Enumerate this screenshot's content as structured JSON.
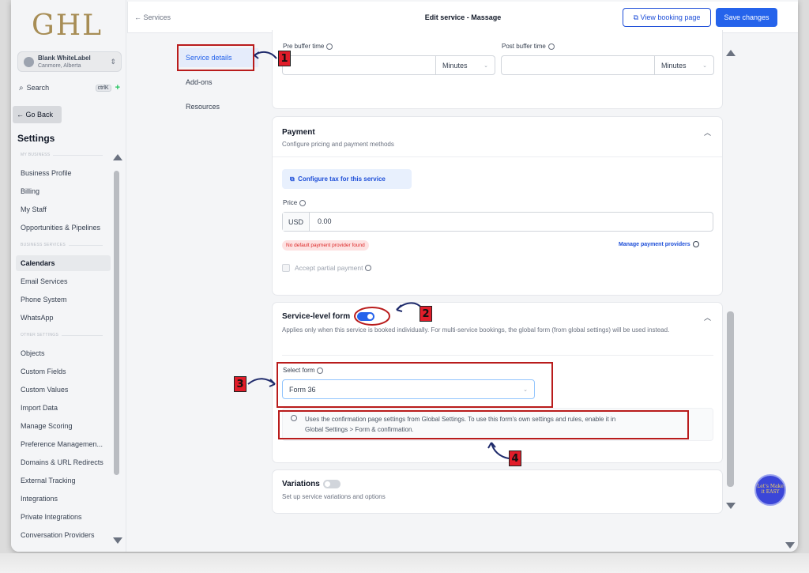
{
  "sidebar": {
    "logo": "GHL",
    "account_name": "Blank WhiteLabel",
    "account_location": "Canmore, Alberta",
    "search_label": "Search",
    "search_shortcut": "ctrlK",
    "go_back": "Go Back",
    "settings_title": "Settings",
    "sections": [
      "MY BUSINESS",
      "BUSINESS SERVICES",
      "OTHER SETTINGS"
    ],
    "items": [
      "Business Profile",
      "Billing",
      "My Staff",
      "Opportunities & Pipelines",
      "Calendars",
      "Email Services",
      "Phone System",
      "WhatsApp",
      "Objects",
      "Custom Fields",
      "Custom Values",
      "Import Data",
      "Manage Scoring",
      "Preference Managemen...",
      "Domains & URL Redirects",
      "External Tracking",
      "Integrations",
      "Private Integrations",
      "Conversation Providers"
    ],
    "active_item": "Calendars"
  },
  "header": {
    "back_label": "Services",
    "title": "Edit service - Massage",
    "view_booking": "View booking page",
    "save": "Save changes"
  },
  "subnav": [
    "Service details",
    "Add-ons",
    "Resources"
  ],
  "buffer": {
    "pre_label": "Pre buffer time",
    "post_label": "Post buffer time",
    "unit": "Minutes"
  },
  "payment": {
    "title": "Payment",
    "subtitle": "Configure pricing and payment methods",
    "tax_button": "Configure tax for this service",
    "price_label": "Price",
    "currency": "USD",
    "price_value": "0.00",
    "warning": "No default payment provider found",
    "manage_link": "Manage payment providers",
    "partial_label": "Accept partial payment"
  },
  "service_form": {
    "title": "Service-level form",
    "enabled": true,
    "description": "Applies only when this service is booked individually. For multi-service bookings, the global form (from global settings) will be used instead.",
    "select_label": "Select form",
    "selected_form": "Form 36",
    "info_line1": "Uses the confirmation page settings from Global Settings. To use this form's own settings and rules, enable it in",
    "info_line2": "Global Settings > Form & confirmation."
  },
  "variations": {
    "title": "Variations",
    "enabled": false,
    "subtitle": "Set up service variations and options"
  },
  "annotations": [
    "1",
    "2",
    "3",
    "4"
  ],
  "fab_text": "Let's Make it EASY",
  "colors": {
    "accent": "#2563eb",
    "annotation_red": "#b91c1c",
    "badge_red": "#e11d2a",
    "logo_gold": "#a78d55"
  }
}
